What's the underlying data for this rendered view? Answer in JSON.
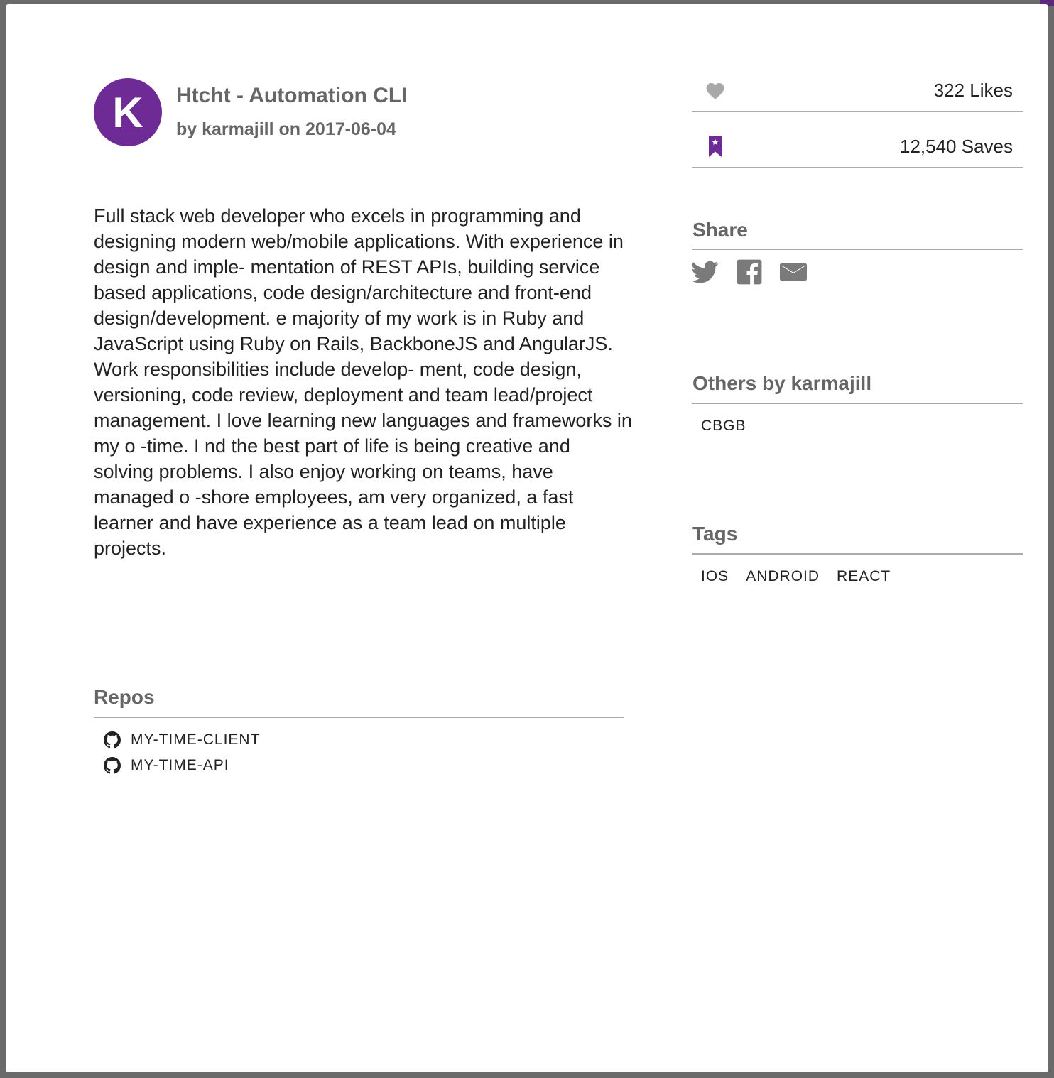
{
  "header": {
    "avatar_initial": "K",
    "title": "Htcht - Automation CLI",
    "byline": "by karmajill on 2017-06-04"
  },
  "description": "Full stack web developer who excels in programming and designing modern web/mobile applications. With experience in design and imple- mentation of REST APIs, building service based applications, code design/architecture and front-end design/development. e majority of my work is in Ruby and JavaScript using Ruby on Rails, BackboneJS and AngularJS. Work responsibilities include develop- ment, code design, versioning, code review, deployment and team lead/project management. I love learning new languages and frameworks in my o -time. I nd the best part of life is being creative and solving problems. I also enjoy working on teams, have managed o -shore employees, am very organized, a fast learner and have experience as a team lead on multiple projects.",
  "repos": {
    "title": "Repos",
    "items": [
      {
        "name": "MY-TIME-CLIENT",
        "icon": "github-icon"
      },
      {
        "name": "MY-TIME-API",
        "icon": "github-icon"
      }
    ]
  },
  "stats": {
    "likes": {
      "value": "322 Likes",
      "icon": "heart-icon"
    },
    "saves": {
      "value": "12,540 Saves",
      "icon": "bookmark-icon"
    }
  },
  "share": {
    "title": "Share",
    "icons": [
      "twitter-icon",
      "facebook-icon",
      "email-icon"
    ]
  },
  "others": {
    "title": "Others by karmajill",
    "items": [
      "CBGB"
    ]
  },
  "tags": {
    "title": "Tags",
    "items": [
      "IOS",
      "ANDROID",
      "REACT"
    ]
  },
  "colors": {
    "accent": "#6e2b95",
    "heading": "#666666",
    "text": "#222222",
    "rule": "#aaaaaa",
    "icon_gray": "#8a8a8a"
  }
}
